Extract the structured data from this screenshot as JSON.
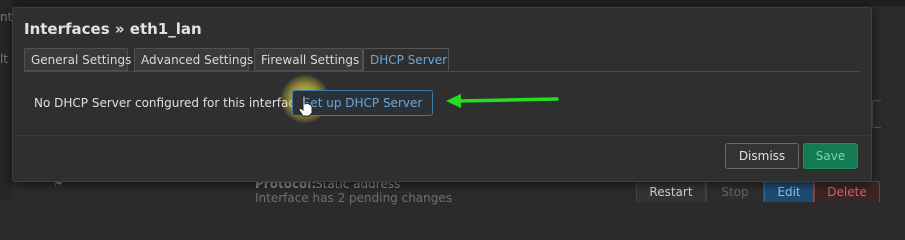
{
  "background": {
    "frag_top": "nt",
    "frag_left": "lt",
    "row": {
      "protocol_label": "Protocol:",
      "protocol_value": "Static address",
      "note": "Interface has 2 pending changes"
    },
    "buttons": {
      "restart": "Restart",
      "stop": "Stop",
      "edit": "Edit",
      "delete": "Delete"
    }
  },
  "modal": {
    "title": "Interfaces » eth1_lan",
    "tabs": [
      {
        "label": "General Settings"
      },
      {
        "label": "Advanced Settings"
      },
      {
        "label": "Firewall Settings"
      },
      {
        "label": "DHCP Server"
      }
    ],
    "active_tab": "DHCP Server",
    "message": "No DHCP Server configured for this interface",
    "setup_button": "Set up DHCP Server",
    "dismiss_button": "Dismiss",
    "save_button": "Save"
  },
  "colors": {
    "accent": "#6aa7d8",
    "save": "#147a52",
    "arrow": "#22dd22",
    "highlight": "#ffec5a"
  }
}
